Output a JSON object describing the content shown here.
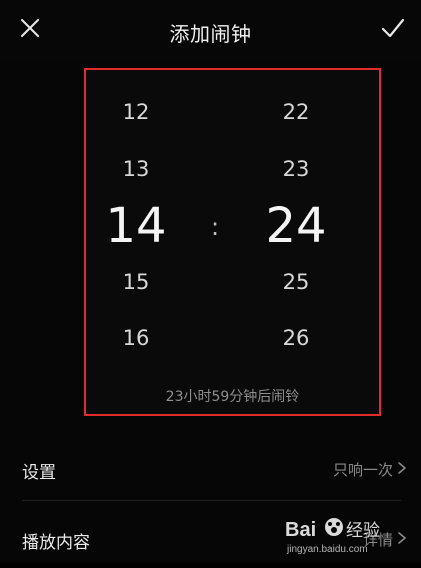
{
  "header": {
    "title": "添加闹钟",
    "close_icon": "close-icon",
    "confirm_icon": "check-icon"
  },
  "picker": {
    "hours": [
      "12",
      "13",
      "14",
      "15",
      "16"
    ],
    "selected_hour": "14",
    "separator": ":",
    "minutes": [
      "22",
      "23",
      "24",
      "25",
      "26"
    ],
    "selected_minute": "24",
    "remaining_text": "23小时59分钟后闹铃",
    "highlight_color": "#e22b2b"
  },
  "rows": {
    "settings": {
      "label": "设置",
      "value": "只响一次",
      "chevron_icon": "chevron-right-icon"
    },
    "playback": {
      "label": "播放内容",
      "value": "详情",
      "chevron_icon": "chevron-right-icon"
    }
  },
  "watermark": {
    "brand": "Bai经验",
    "url": "jingyan.baidu.com"
  }
}
